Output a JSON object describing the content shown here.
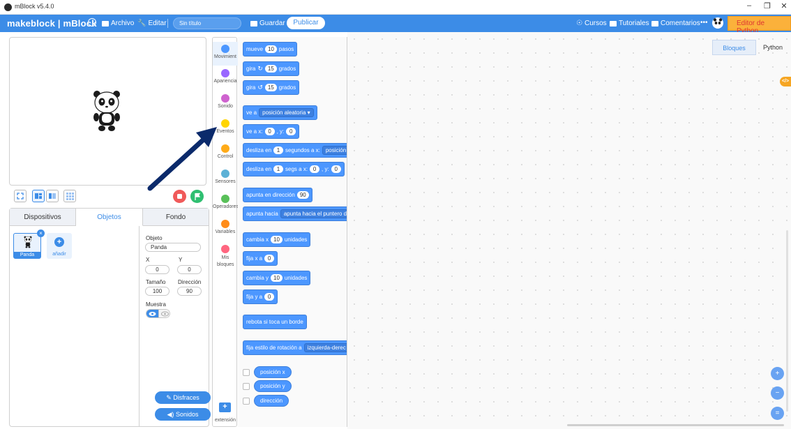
{
  "window": {
    "title": "mBlock v5.4.0",
    "controls": [
      "–",
      "❐",
      "✕"
    ]
  },
  "menubar": {
    "brand": "makeblock | mBlock",
    "archivo": "Archivo",
    "editar": "Editar",
    "filename": "Sin título",
    "guardar": "Guardar",
    "publicar": "Publicar",
    "cursos": "Cursos",
    "tutoriales": "Tutoriales",
    "comentarios": "Comentarios",
    "more": "•••",
    "python_editor": "Editor de Python"
  },
  "sprite_panel": {
    "tabs": [
      "Dispositivos",
      "Objetos",
      "Fondo"
    ],
    "active_tab": "Objetos",
    "sprite_name": "Panda",
    "add_label": "añadir",
    "labels": {
      "objeto": "Objeto",
      "x": "X",
      "y": "Y",
      "tamano": "Tamaño",
      "direccion": "Dirección",
      "muestra": "Muestra"
    },
    "values": {
      "objeto": "Panda",
      "x": "0",
      "y": "0",
      "tamano": "100",
      "direccion": "90"
    },
    "disfraces": "Disfraces",
    "sonidos": "Sonidos"
  },
  "categories": [
    {
      "label": "Movimient",
      "color": "#4c97ff"
    },
    {
      "label": "Apariencia",
      "color": "#9966ff"
    },
    {
      "label": "Sonido",
      "color": "#cf63cf"
    },
    {
      "label": "Eventos",
      "color": "#ffd500"
    },
    {
      "label": "Control",
      "color": "#ffab19"
    },
    {
      "label": "Sensores",
      "color": "#5cb1d6"
    },
    {
      "label": "Operadores",
      "color": "#59c059"
    },
    {
      "label": "Variables",
      "color": "#ff8c1a"
    },
    {
      "label": "Mis bloques",
      "color": "#ff6680"
    }
  ],
  "extension_label": "extensión",
  "blocks": {
    "mueve": {
      "pre": "mueve",
      "val": "10",
      "post": "pasos"
    },
    "gira_r": {
      "pre": "gira",
      "val": "15",
      "post": "grados"
    },
    "gira_l": {
      "pre": "gira",
      "val": "15",
      "post": "grados"
    },
    "ve_a": {
      "pre": "ve a",
      "dd": "posición aleatoria ▾"
    },
    "ve_a_xy": {
      "pre": "ve a x:",
      "x": "0",
      "mid": ", y:",
      "y": "0"
    },
    "desliza1": {
      "pre": "desliza en",
      "val": "1",
      "mid": "segundos a x:",
      "dd": "posición"
    },
    "desliza2": {
      "pre": "desliza en",
      "val": "1",
      "mid": "segs a x:",
      "x": "0",
      "mid2": ", y:",
      "y": "0"
    },
    "apunta_dir": {
      "pre": "apunta en dirección",
      "val": "90"
    },
    "apunta_hacia": {
      "pre": "apunta hacia",
      "dd": "apunta hacia el puntero d"
    },
    "cambia_x": {
      "pre": "cambia x",
      "val": "10",
      "post": "unidades"
    },
    "fija_x": {
      "pre": "fija x a",
      "val": "0"
    },
    "cambia_y": {
      "pre": "cambia y",
      "val": "10",
      "post": "unidades"
    },
    "fija_y": {
      "pre": "fija y a",
      "val": "0"
    },
    "rebota": "rebota si toca un borde",
    "estilo": {
      "pre": "fija estilo de rotación a",
      "dd": "izquierda-derec"
    },
    "reporters": [
      "posición x",
      "posición y",
      "dirección"
    ]
  },
  "workspace": {
    "tabs": [
      "Bloques",
      "Python"
    ],
    "active_tab": "Bloques"
  },
  "colors": {
    "accent": "#3c8ce7",
    "motion": "#4c97ff",
    "python_editor_bg": "#fbb13b",
    "python_editor_text": "#dd3333",
    "stop": "#f05a5a",
    "go": "#2fbf71",
    "annotation_arrow": "#0b2a6b"
  }
}
